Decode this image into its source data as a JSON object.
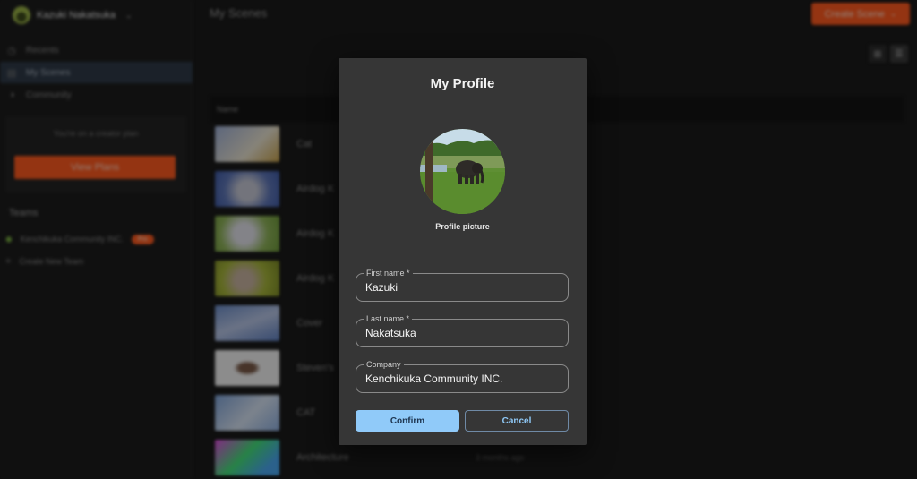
{
  "background": {
    "user": {
      "name": "Kazuki Nakatsuka"
    },
    "nav": [
      {
        "label": "Recents",
        "icon": "clock-icon",
        "active": false
      },
      {
        "label": "My Scenes",
        "icon": "folder-icon",
        "active": true
      },
      {
        "label": "Community",
        "icon": "globe-icon",
        "active": false
      }
    ],
    "plan": {
      "text": "You're on a creator plan",
      "button": "View Plans"
    },
    "teams": {
      "label": "Teams",
      "team": {
        "name": "Kenchikuka Community INC.",
        "badge": "Pro"
      },
      "create": "Create New Team"
    },
    "main": {
      "title": "My Scenes",
      "create_button": "Create Scene",
      "table_header": "Name",
      "scenes": [
        {
          "name": "Cat",
          "date": ""
        },
        {
          "name": "Airdog K",
          "date": ""
        },
        {
          "name": "Airdog K",
          "date": ""
        },
        {
          "name": "Airdog K",
          "date": ""
        },
        {
          "name": "Cover",
          "date": ""
        },
        {
          "name": "Steven's",
          "date": ""
        },
        {
          "name": "CAT",
          "date": ""
        },
        {
          "name": "Architecture",
          "date": "3 months ago"
        }
      ]
    }
  },
  "modal": {
    "title": "My Profile",
    "picture_label": "Profile picture",
    "fields": {
      "first_name": {
        "label": "First name *",
        "value": "Kazuki"
      },
      "last_name": {
        "label": "Last name *",
        "value": "Nakatsuka"
      },
      "company": {
        "label": "Company",
        "value": "Kenchikuka Community INC."
      }
    },
    "confirm_label": "Confirm",
    "cancel_label": "Cancel"
  },
  "colors": {
    "accent_orange": "#ff5a1f",
    "confirm_blue": "#90caf9",
    "modal_bg": "#363636"
  }
}
